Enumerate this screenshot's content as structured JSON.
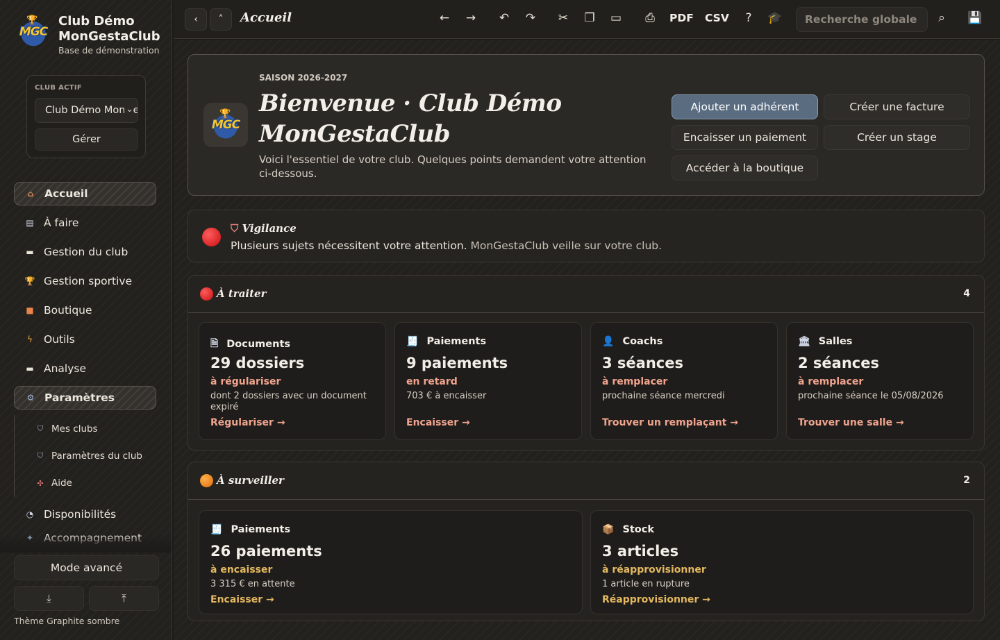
{
  "brand": {
    "name": "Club Démo MonGestaClub",
    "subtitle": "Base de démonstration",
    "logo_text": "MGC"
  },
  "club_box": {
    "label": "CLUB ACTIF",
    "selected": "Club Démo MonGestaClub",
    "manage_label": "Gérer"
  },
  "nav": {
    "items": [
      {
        "label": "Accueil",
        "icon": "home-icon"
      },
      {
        "label": "À faire",
        "icon": "clipboard-icon"
      },
      {
        "label": "Gestion du club",
        "icon": "folder-icon"
      },
      {
        "label": "Gestion sportive",
        "icon": "trophy-icon"
      },
      {
        "label": "Boutique",
        "icon": "shopping-bag-icon"
      },
      {
        "label": "Outils",
        "icon": "lightning-icon"
      },
      {
        "label": "Analyse",
        "icon": "folder-icon"
      },
      {
        "label": "Paramètres",
        "icon": "gear-icon"
      }
    ],
    "sub_items": [
      {
        "label": "Mes clubs",
        "icon": "shield-icon"
      },
      {
        "label": "Paramètres du club",
        "icon": "shield-gear-icon"
      },
      {
        "label": "Aide",
        "icon": "lifebuoy-icon"
      }
    ],
    "after": [
      {
        "label": "Disponibilités",
        "icon": "calendar-check-icon"
      },
      {
        "label": "Accompagnement",
        "icon": "sparkle-icon"
      }
    ]
  },
  "sidebar_footer": {
    "mode_label": "Mode avancé",
    "download_icon": "download-icon",
    "upload_icon": "upload-icon",
    "theme_label": "Thème Graphite sombre"
  },
  "toolbar": {
    "title": "Accueil",
    "pdf_label": "PDF",
    "csv_label": "CSV",
    "search_placeholder": "Recherche globale"
  },
  "welcome": {
    "season": "SAISON 2026-2027",
    "title": "Bienvenue · Club Démo MonGestaClub",
    "description": "Voici l'essentiel de votre club. Quelques points demandent votre attention ci-dessous.",
    "actions": [
      "Ajouter un adhérent",
      "Créer une facture",
      "Encaisser un paiement",
      "Créer un stage",
      "Accéder à la boutique"
    ]
  },
  "vigilance": {
    "title": "Vigilance",
    "text": "Plusieurs sujets nécessitent votre attention.",
    "text_muted": "MonGestaClub veille sur votre club."
  },
  "a_traiter": {
    "title": "À traiter",
    "count": "4",
    "cards": [
      {
        "category": "Documents",
        "icon": "document-icon",
        "headline": "29 dossiers",
        "status": "à régulariser",
        "detail": "dont 2 dossiers avec un document expiré",
        "link": "Régulariser →"
      },
      {
        "category": "Paiements",
        "icon": "receipt-icon",
        "headline": "9 paiements",
        "status": "en retard",
        "detail": "703 € à encaisser",
        "link": "Encaisser →"
      },
      {
        "category": "Coachs",
        "icon": "coach-icon",
        "headline": "3 séances",
        "status": "à remplacer",
        "detail": "prochaine séance mercredi",
        "link": "Trouver un remplaçant →"
      },
      {
        "category": "Salles",
        "icon": "building-icon",
        "headline": "2 séances",
        "status": "à remplacer",
        "detail": "prochaine séance le 05/08/2026",
        "link": "Trouver une salle →"
      }
    ]
  },
  "a_surveiller": {
    "title": "À surveiller",
    "count": "2",
    "cards": [
      {
        "category": "Paiements",
        "icon": "receipt-icon",
        "headline": "26 paiements",
        "status": "à encaisser",
        "detail": "3 315 € en attente",
        "link": "Encaisser →"
      },
      {
        "category": "Stock",
        "icon": "box-icon",
        "headline": "3 articles",
        "status": "à réapprovisionner",
        "detail": "1 article en rupture",
        "link": "Réapprovisionner →"
      }
    ]
  },
  "colors": {
    "accent_button": "#5a6c80",
    "urgent": "#e0191c",
    "watch": "#f08a1c",
    "urgent_text": "#f0a48e",
    "watch_text": "#e3b860"
  }
}
